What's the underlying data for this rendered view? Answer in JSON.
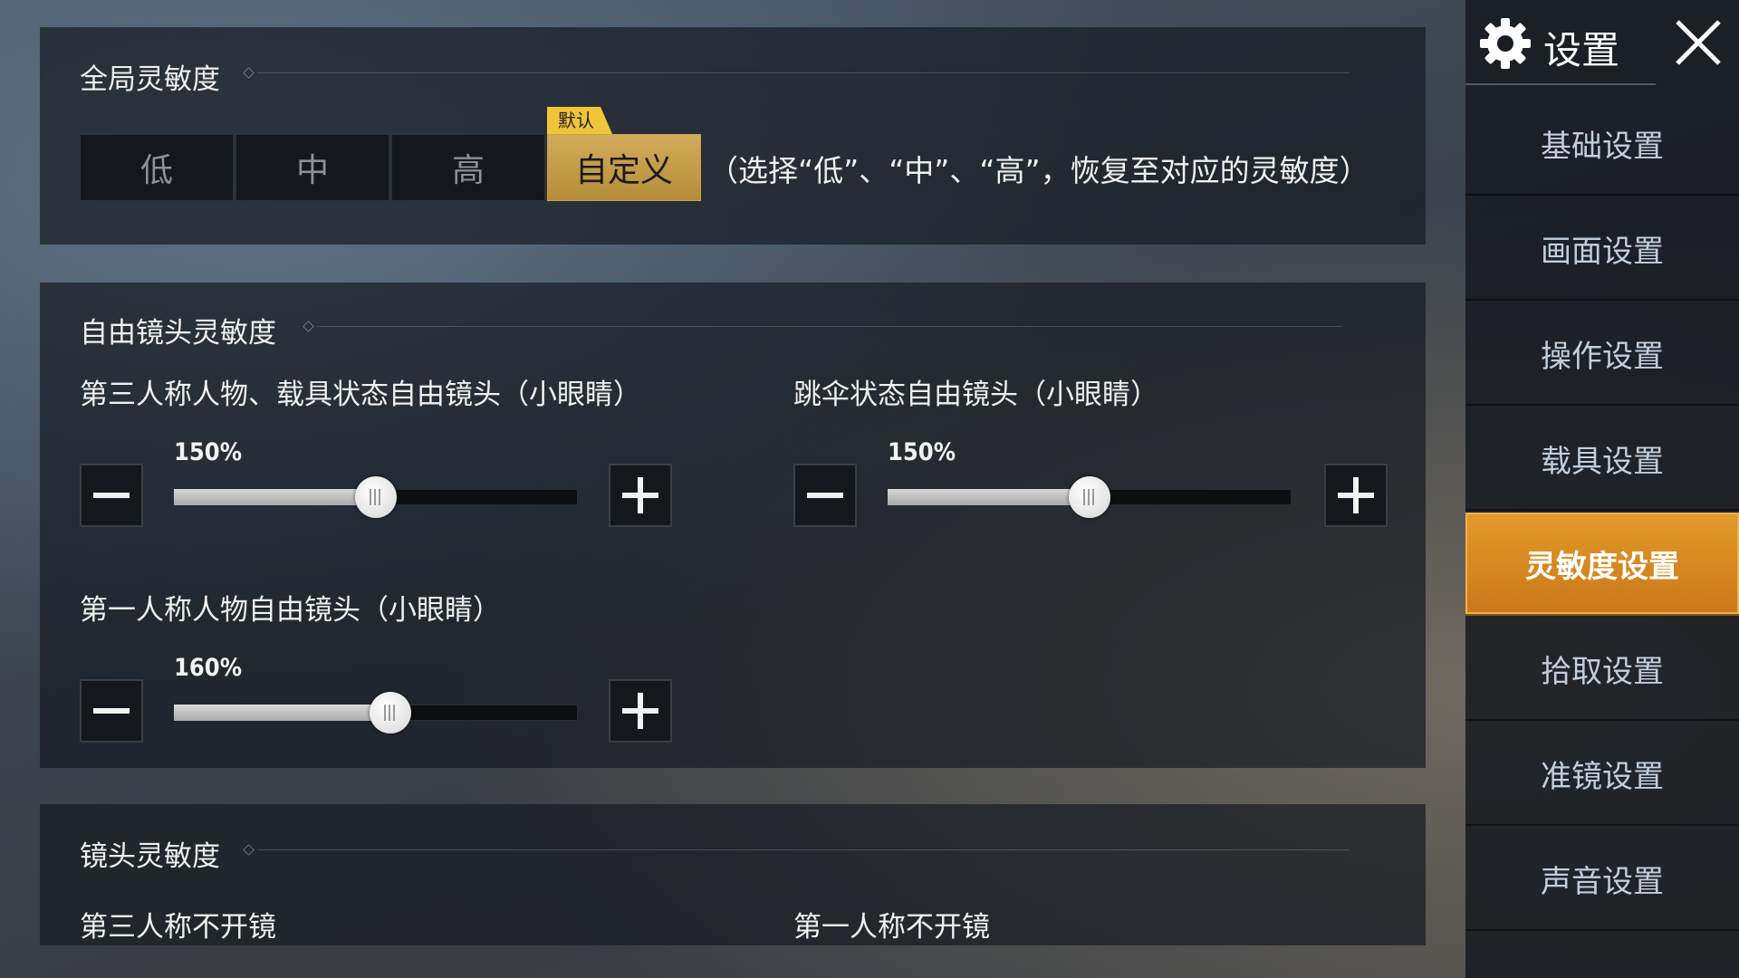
{
  "global_sensitivity": {
    "title": "全局灵敏度",
    "options": [
      "低",
      "中",
      "高",
      "自定义"
    ],
    "selected": "自定义",
    "default_tag": "默认",
    "hint": "（选择“低”、“中”、“高”，恢复至对应的灵敏度）"
  },
  "free_camera": {
    "title": "自由镜头灵敏度",
    "third_person": {
      "label": "第三人称人物、载具状态自由镜头（小眼睛）",
      "value_text": "150%",
      "fraction": 0.5
    },
    "parachute": {
      "label": "跳伞状态自由镜头（小眼睛）",
      "value_text": "150%",
      "fraction": 0.5
    },
    "first_person": {
      "label": "第一人称人物自由镜头（小眼睛）",
      "value_text": "160%",
      "fraction": 0.535
    }
  },
  "camera": {
    "title": "镜头灵敏度",
    "third_person_no_scope": "第三人称不开镜",
    "first_person_no_scope": "第一人称不开镜"
  },
  "sidebar": {
    "title": "设置",
    "items": [
      {
        "label": "基础设置"
      },
      {
        "label": "画面设置"
      },
      {
        "label": "操作设置"
      },
      {
        "label": "载具设置"
      },
      {
        "label": "灵敏度设置",
        "active": true
      },
      {
        "label": "拾取设置"
      },
      {
        "label": "准镜设置"
      },
      {
        "label": "声音设置"
      }
    ]
  },
  "colors": {
    "accent": "#d9952a",
    "selected_segment": "#c9a14d",
    "default_tag": "#f1c43a"
  },
  "icons": {
    "settings": "gear-icon",
    "close": "close-icon",
    "minus": "minus-icon",
    "plus": "plus-icon"
  }
}
